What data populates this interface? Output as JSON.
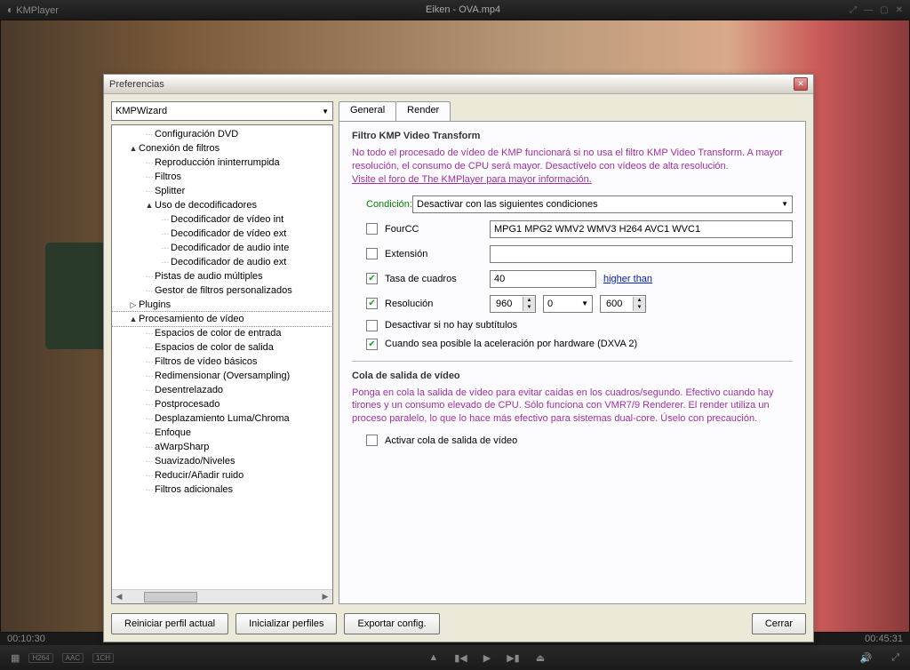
{
  "player": {
    "logo": "KMPlayer",
    "title": "Eiken - OVA.mp4",
    "time_left": "00:10:30",
    "time_right": "00:45:31",
    "badges": [
      "H264",
      "AAC",
      "1CH"
    ]
  },
  "pref": {
    "title": "Preferencias",
    "wizard": "KMPWizard",
    "tree": [
      {
        "lvl": 2,
        "t": "",
        "label": "Configuración DVD"
      },
      {
        "lvl": 1,
        "t": "▲",
        "label": "Conexión de filtros"
      },
      {
        "lvl": 2,
        "t": "",
        "label": "Reproducción ininterrumpida"
      },
      {
        "lvl": 2,
        "t": "",
        "label": "Filtros"
      },
      {
        "lvl": 2,
        "t": "",
        "label": "Splitter"
      },
      {
        "lvl": 2,
        "t": "▲",
        "label": "Uso de decodificadores"
      },
      {
        "lvl": 3,
        "t": "",
        "label": "Decodificador de vídeo int"
      },
      {
        "lvl": 3,
        "t": "",
        "label": "Decodificador de vídeo ext"
      },
      {
        "lvl": 3,
        "t": "",
        "label": "Decodificador de audio inte"
      },
      {
        "lvl": 3,
        "t": "",
        "label": "Decodificador de audio ext"
      },
      {
        "lvl": 2,
        "t": "",
        "label": "Pistas de audio múltiples"
      },
      {
        "lvl": 2,
        "t": "",
        "label": "Gestor de filtros personalizados"
      },
      {
        "lvl": 1,
        "t": "▷",
        "label": "Plugins"
      },
      {
        "lvl": 1,
        "t": "▲",
        "label": "Procesamiento de vídeo",
        "sel": true
      },
      {
        "lvl": 2,
        "t": "",
        "label": "Espacios de color de entrada"
      },
      {
        "lvl": 2,
        "t": "",
        "label": "Espacios de color de salida"
      },
      {
        "lvl": 2,
        "t": "",
        "label": "Filtros de vídeo básicos"
      },
      {
        "lvl": 2,
        "t": "",
        "label": "Redimensionar (Oversampling)"
      },
      {
        "lvl": 2,
        "t": "",
        "label": "Desentrelazado"
      },
      {
        "lvl": 2,
        "t": "",
        "label": "Postprocesado"
      },
      {
        "lvl": 2,
        "t": "",
        "label": "Desplazamiento Luma/Chroma"
      },
      {
        "lvl": 2,
        "t": "",
        "label": "Enfoque"
      },
      {
        "lvl": 2,
        "t": "",
        "label": "aWarpSharp"
      },
      {
        "lvl": 2,
        "t": "",
        "label": "Suavizado/Niveles"
      },
      {
        "lvl": 2,
        "t": "",
        "label": "Reducir/Añadir ruido"
      },
      {
        "lvl": 2,
        "t": "",
        "label": "Filtros adicionales"
      }
    ],
    "tabs": {
      "general": "General",
      "render": "Render"
    },
    "section1": {
      "title": "Filtro KMP Video Transform",
      "desc1": "No todo el procesado de vídeo de KMP funcionará si no usa el filtro KMP Video Transform. A mayor resolución, el consumo de CPU será mayor. Desactívelo con vídeos de alta resolución.",
      "desc2": "Visite el foro de The KMPlayer para mayor información.",
      "cond_label": "Condición:",
      "cond_value": "Desactivar con las siguientes condiciones",
      "fourcc_label": "FourCC",
      "fourcc_value": "MPG1 MPG2 WMV2 WMV3 H264 AVC1 WVC1",
      "ext_label": "Extensión",
      "ext_value": "",
      "fps_label": "Tasa de cuadros",
      "fps_value": "40",
      "fps_suffix": "higher than",
      "res_label": "Resolución",
      "res_w": "960",
      "res_mid": "0",
      "res_h": "600",
      "nosub_label": "Desactivar si no hay subtítulos",
      "dxva_label": "Cuando sea posible la aceleración por hardware (DXVA 2)"
    },
    "section2": {
      "title": "Cola de salida de vídeo",
      "desc": "Ponga en cola la salida de vídeo para evitar caídas en los cuadros/segundo. Efectivo cuando hay tirones y un consumo elevado de CPU. Sólo funciona con VMR7/9 Renderer. El render utiliza un proceso paralelo, lo que lo hace más efectivo para sistemas dual-core. Úselo con precaución.",
      "enable_label": "Activar cola de salida de vídeo"
    },
    "buttons": {
      "reset": "Reiniciar perfil actual",
      "init": "Inicializar perfiles",
      "export": "Exportar config.",
      "close": "Cerrar"
    }
  }
}
